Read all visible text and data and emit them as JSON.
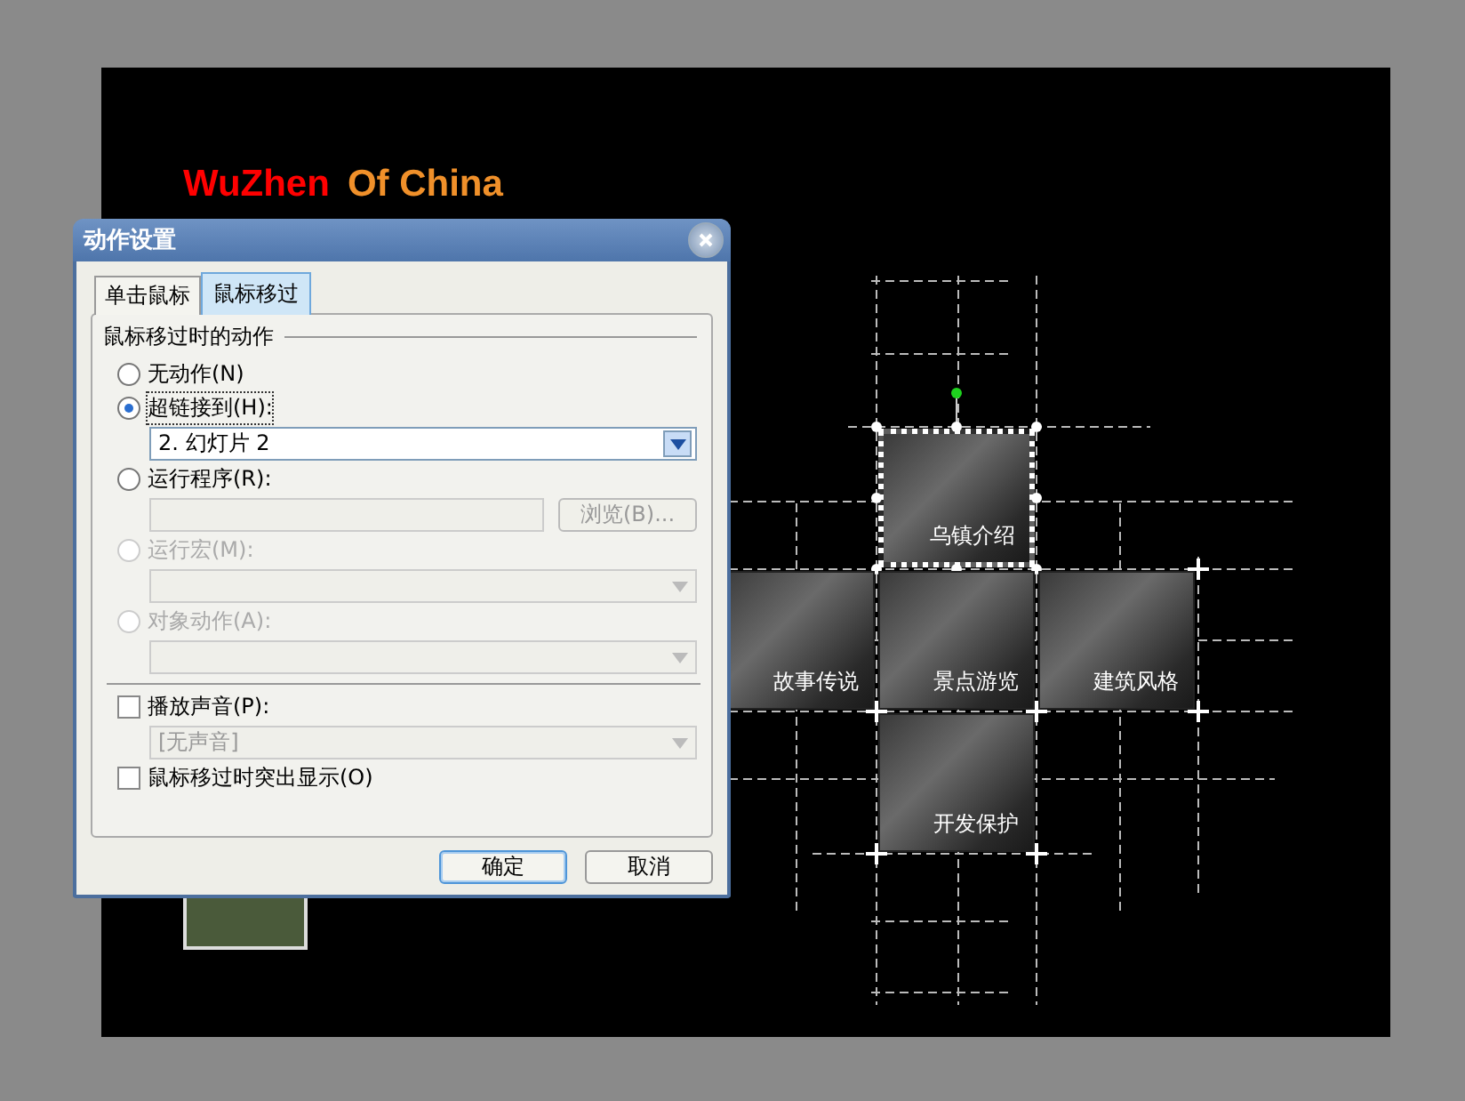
{
  "slide": {
    "title": [
      {
        "text": "WuZhen",
        "color": "#ff0000"
      },
      {
        "text": "Of China",
        "color": "#f0902a"
      }
    ],
    "tiles": [
      {
        "label": "乌镇介绍",
        "selected": true
      },
      {
        "label": "故事传说",
        "selected": false
      },
      {
        "label": "景点游览",
        "selected": false
      },
      {
        "label": "建筑风格",
        "selected": false
      },
      {
        "label": "开发保护",
        "selected": false
      }
    ]
  },
  "dialog": {
    "title": "动作设置",
    "tabs": [
      {
        "label": "单击鼠标",
        "selected": false
      },
      {
        "label": "鼠标移过",
        "selected": true
      }
    ],
    "group_title": "鼠标移过时的动作",
    "options": [
      {
        "label": "无动作(N)",
        "selected": false,
        "disabled": false
      },
      {
        "label": "超链接到(H):",
        "selected": true,
        "disabled": false,
        "field": {
          "kind": "select",
          "value": "2. 幻灯片 2",
          "disabled": false
        }
      },
      {
        "label": "运行程序(R):",
        "selected": false,
        "disabled": false,
        "field": {
          "kind": "text",
          "disabled": true,
          "button": "浏览(B)..."
        }
      },
      {
        "label": "运行宏(M):",
        "selected": false,
        "disabled": true,
        "field": {
          "kind": "select",
          "disabled": true
        }
      },
      {
        "label": "对象动作(A):",
        "selected": false,
        "disabled": true,
        "field": {
          "kind": "select",
          "disabled": true
        }
      }
    ],
    "sound": {
      "label": "播放声音(P):",
      "checked": false,
      "field": {
        "kind": "select",
        "value": "[无声音]",
        "disabled": true
      }
    },
    "highlight": {
      "label": "鼠标移过时突出显示(O)",
      "checked": false
    },
    "buttons": [
      {
        "label": "确定",
        "default": true
      },
      {
        "label": "取消",
        "default": false
      }
    ]
  }
}
